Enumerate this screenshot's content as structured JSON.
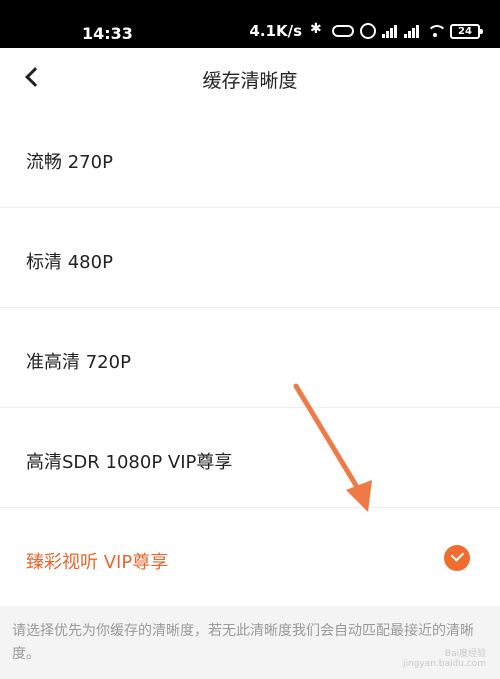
{
  "status_bar": {
    "time": "14:33",
    "network_speed": "4.1K/s",
    "battery": "24",
    "icons": [
      "bluetooth-icon",
      "vpn-icon",
      "alarm-icon",
      "signal-icon",
      "signal-icon",
      "wifi-icon",
      "battery-icon"
    ]
  },
  "header": {
    "title": "缓存清晰度",
    "back_icon": "back-arrow-icon"
  },
  "options": [
    {
      "label": "流畅  270P",
      "selected": false
    },
    {
      "label": "标清  480P",
      "selected": false
    },
    {
      "label": "准高清  720P",
      "selected": false
    },
    {
      "label": "高清SDR  1080P  VIP尊享",
      "selected": false
    },
    {
      "label": "臻彩视听  VIP尊享",
      "selected": true
    }
  ],
  "hint": "请选择优先为你缓存的清晰度，若无此清晰度我们会自动匹配最接近的清晰度。",
  "colors": {
    "accent": "#f06d2f",
    "selected_text": "#e8662f",
    "annotation_arrow": "#f07a45"
  },
  "watermark": {
    "line1": "Bai度经验",
    "line2": "jingyan.baidu.com"
  }
}
